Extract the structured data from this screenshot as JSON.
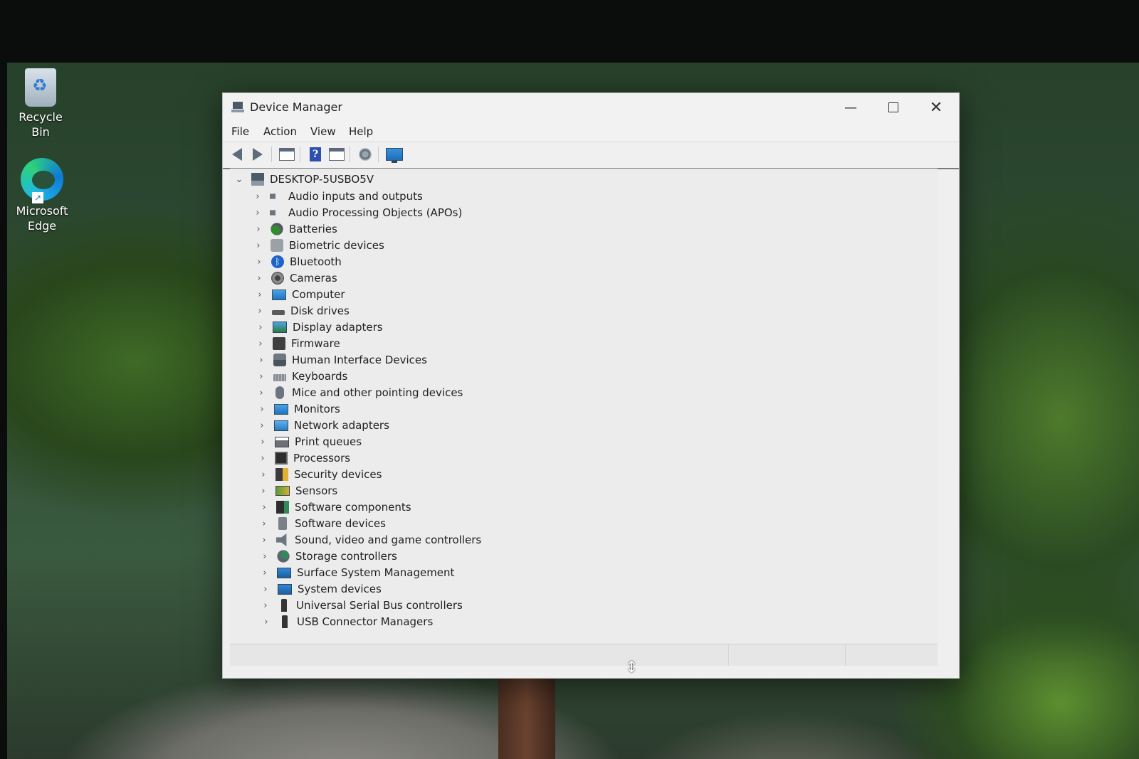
{
  "desktop": {
    "icons": [
      {
        "label": "Recycle Bin",
        "icon": "recycle-bin-icon"
      },
      {
        "label": "Microsoft\nEdge",
        "icon": "edge-icon"
      }
    ]
  },
  "window": {
    "title": "Device Manager",
    "controls": {
      "minimize": "—",
      "close": "✕"
    }
  },
  "menu": [
    "File",
    "Action",
    "View",
    "Help"
  ],
  "toolbar": [
    "back-arrow-icon",
    "forward-arrow-icon",
    "properties-panel-icon",
    "help-icon",
    "details-panel-icon",
    "scan-hardware-icon",
    "monitor-icon"
  ],
  "tree": {
    "root": "DESKTOP-5USBO5V",
    "items": [
      {
        "label": "Audio inputs and outputs",
        "icon": "speaker-icon"
      },
      {
        "label": "Audio Processing Objects (APOs)",
        "icon": "speaker-icon"
      },
      {
        "label": "Batteries",
        "icon": "battery-icon"
      },
      {
        "label": "Biometric devices",
        "icon": "fingerprint-icon"
      },
      {
        "label": "Bluetooth",
        "icon": "bluetooth-icon"
      },
      {
        "label": "Cameras",
        "icon": "camera-icon"
      },
      {
        "label": "Computer",
        "icon": "computer-icon"
      },
      {
        "label": "Disk drives",
        "icon": "disk-drive-icon"
      },
      {
        "label": "Display adapters",
        "icon": "display-adapter-icon"
      },
      {
        "label": "Firmware",
        "icon": "firmware-icon"
      },
      {
        "label": "Human Interface Devices",
        "icon": "hid-icon"
      },
      {
        "label": "Keyboards",
        "icon": "keyboard-icon"
      },
      {
        "label": "Mice and other pointing devices",
        "icon": "mouse-icon"
      },
      {
        "label": "Monitors",
        "icon": "monitor-icon"
      },
      {
        "label": "Network adapters",
        "icon": "network-adapter-icon"
      },
      {
        "label": "Print queues",
        "icon": "printer-icon"
      },
      {
        "label": "Processors",
        "icon": "processor-icon"
      },
      {
        "label": "Security devices",
        "icon": "security-device-icon"
      },
      {
        "label": "Sensors",
        "icon": "sensor-icon"
      },
      {
        "label": "Software components",
        "icon": "software-component-icon"
      },
      {
        "label": "Software devices",
        "icon": "software-device-icon"
      },
      {
        "label": "Sound, video and game controllers",
        "icon": "sound-controller-icon"
      },
      {
        "label": "Storage controllers",
        "icon": "storage-controller-icon"
      },
      {
        "label": "Surface System Management",
        "icon": "surface-icon"
      },
      {
        "label": "System devices",
        "icon": "system-device-icon"
      },
      {
        "label": "Universal Serial Bus controllers",
        "icon": "usb-icon"
      },
      {
        "label": "USB Connector Managers",
        "icon": "usb-icon"
      }
    ]
  }
}
